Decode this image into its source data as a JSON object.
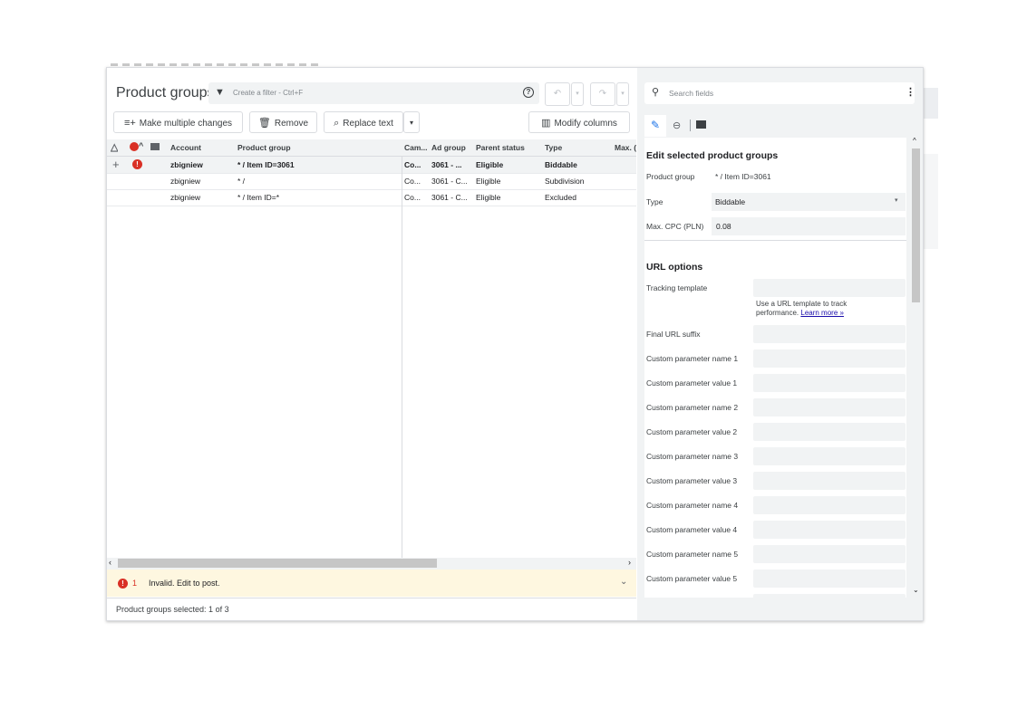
{
  "toolbar": {
    "title": "Product groups",
    "filter_placeholder": "Create a filter - Ctrl+F",
    "make_changes": "Make multiple changes",
    "remove": "Remove",
    "replace": "Replace text",
    "modify_columns": "Modify columns"
  },
  "grid": {
    "headers": [
      "Account",
      "Product group",
      "Cam...",
      "Ad group",
      "Parent status",
      "Type",
      "Max. ("
    ],
    "rows": [
      {
        "account": "zbigniew",
        "product_group": "* / Item ID=3061",
        "campaign": "Co...",
        "ad_group": "3061 - ...",
        "parent_status": "Eligible",
        "type": "Biddable"
      },
      {
        "account": "zbigniew",
        "product_group": "* /",
        "campaign": "Co...",
        "ad_group": "3061 - C...",
        "parent_status": "Eligible",
        "type": "Subdivision"
      },
      {
        "account": "zbigniew",
        "product_group": "* / Item ID=*",
        "campaign": "Co...",
        "ad_group": "3061 - C...",
        "parent_status": "Eligible",
        "type": "Excluded"
      }
    ]
  },
  "error_bar": {
    "count": "1",
    "message": "Invalid. Edit to post."
  },
  "status_bar": {
    "text": "Product groups selected: 1 of 3"
  },
  "side": {
    "search_placeholder": "Search fields",
    "section_title": "Edit selected product groups",
    "product_group_label": "Product group",
    "product_group_value": "* / Item ID=3061",
    "type_label": "Type",
    "type_value": "Biddable",
    "maxcpc_label": "Max. CPC (PLN)",
    "maxcpc_value": "0.08",
    "url_title": "URL options",
    "tracking_label": "Tracking template",
    "tracking_hint": "Use a URL template to track performance.",
    "learn_more": "Learn more »",
    "final_url_label": "Final URL suffix",
    "custom_params": [
      "Custom parameter name 1",
      "Custom parameter value 1",
      "Custom parameter name 2",
      "Custom parameter value 2",
      "Custom parameter name 3",
      "Custom parameter value 3",
      "Custom parameter name 4",
      "Custom parameter value 4",
      "Custom parameter name 5",
      "Custom parameter value 5"
    ]
  },
  "colors": {
    "accent": "#1a73e8",
    "error": "#d93025",
    "warning_bg": "#fef7e0"
  }
}
